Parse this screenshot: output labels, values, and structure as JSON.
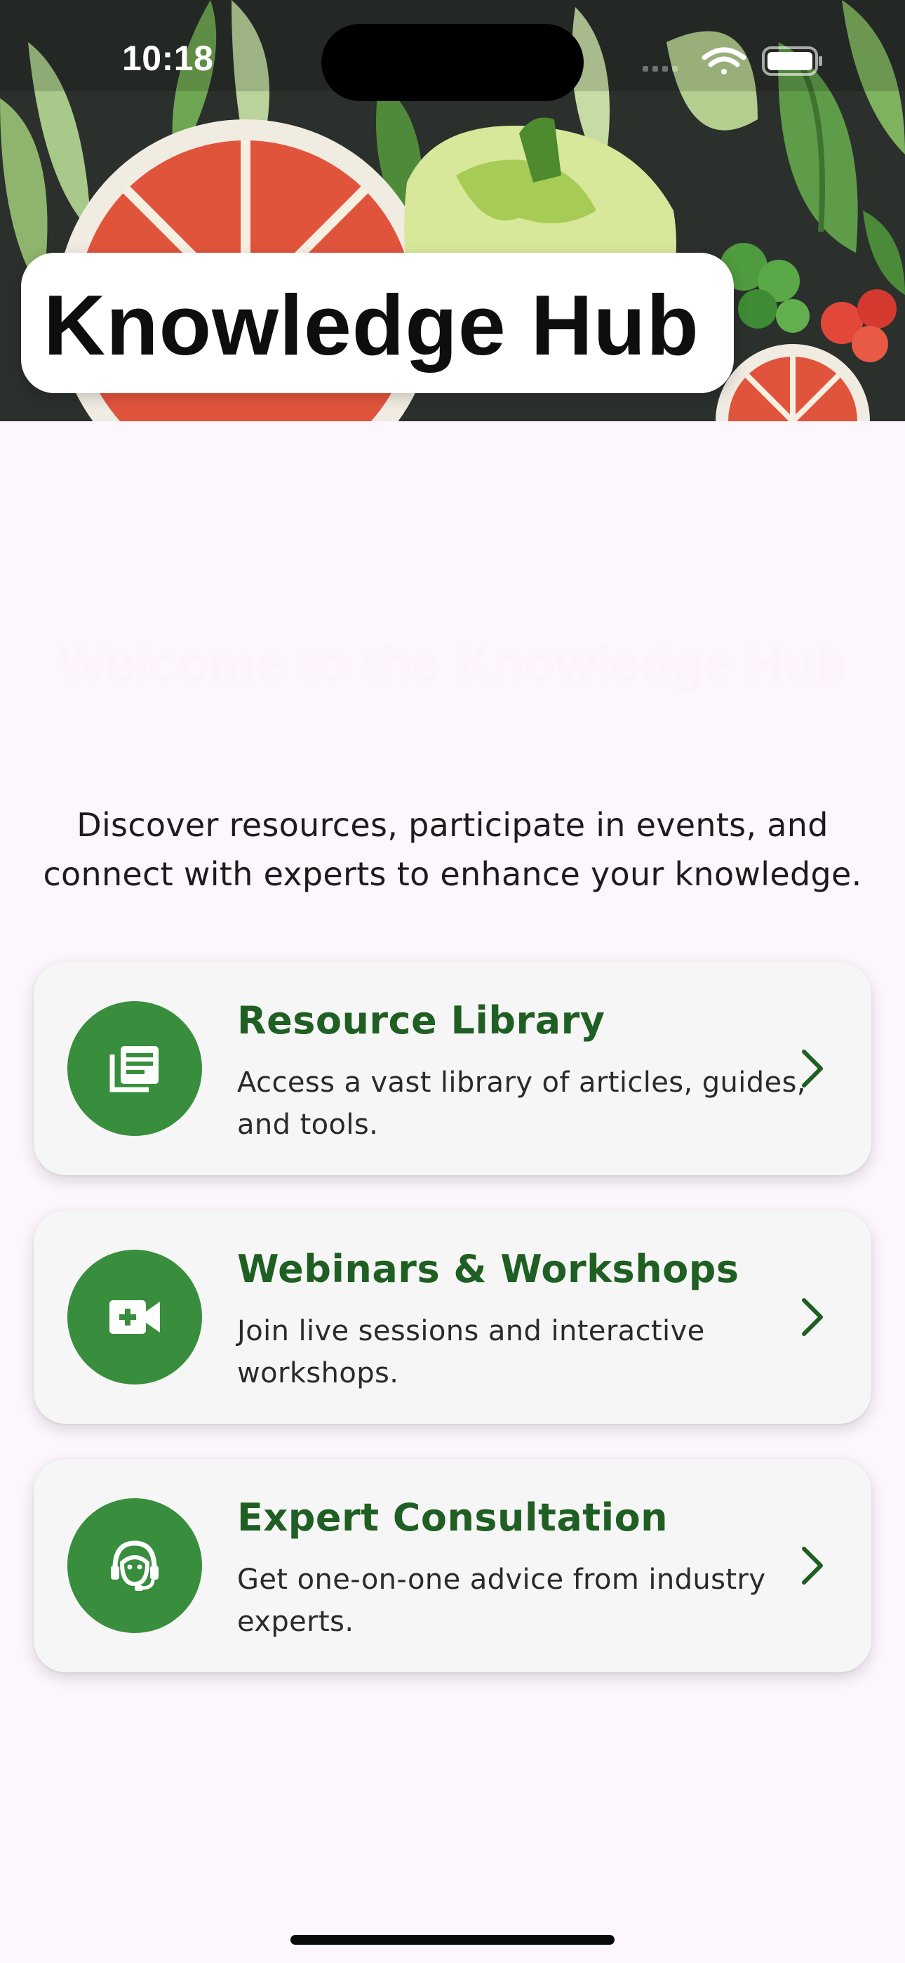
{
  "status_bar": {
    "time": "10:18"
  },
  "hero": {
    "title": "Knowledge Hub"
  },
  "welcome": {
    "heading": "Welcome to the Knowledge Hub",
    "description": "Discover resources, participate in events, and connect with experts to enhance your knowledge."
  },
  "cards": [
    {
      "title": "Resource Library",
      "description": "Access a vast library of articles, guides, and tools.",
      "icon": "library-books-icon"
    },
    {
      "title": "Webinars & Workshops",
      "description": "Join live sessions and interactive workshops.",
      "icon": "video-call-icon"
    },
    {
      "title": "Expert Consultation",
      "description": "Get one-on-one advice from industry experts.",
      "icon": "support-agent-icon"
    }
  ],
  "colors": {
    "background": "#fdf6fd",
    "accent_green": "#388e3c",
    "title_green": "#1f5f23",
    "card_bg": "#f7f6f6"
  }
}
